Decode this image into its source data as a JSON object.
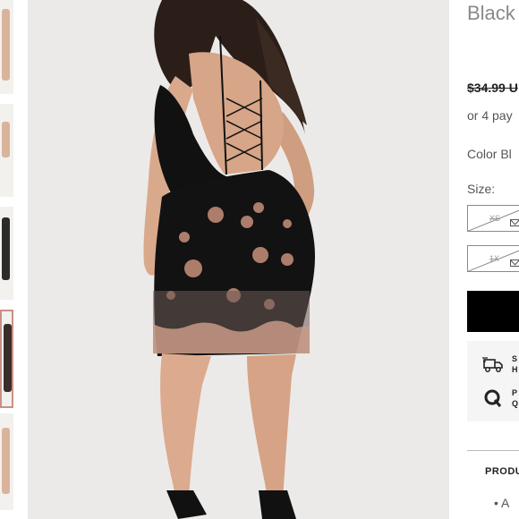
{
  "product": {
    "title": "Black",
    "price": "$34.99 U",
    "installments": "or 4 pay",
    "color_line": "Color Bl",
    "size_label": "Size:"
  },
  "sizes": [
    {
      "label": "XS",
      "available": false
    },
    {
      "label": "1X",
      "available": false
    }
  ],
  "info": {
    "shipping_text": [
      "S",
      "H"
    ],
    "payment_text": [
      "P",
      "Q"
    ]
  },
  "details": {
    "heading": "PRODU",
    "bullet": "A"
  },
  "colors": {
    "accent": "#000000",
    "muted_text": "#8a8a8a",
    "info_bg": "#f5f5f5",
    "thumb_active_border": "#c98f86"
  },
  "icons": [
    "shipping-truck-icon",
    "payment-icon",
    "mail-icon"
  ]
}
